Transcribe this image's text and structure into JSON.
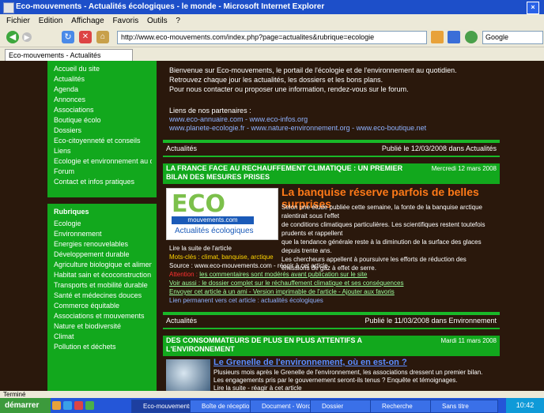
{
  "window": {
    "title": "Eco-mouvements - Actualités écologiques - le monde - Microsoft Internet Explorer"
  },
  "menu": [
    "Fichier",
    "Edition",
    "Affichage",
    "Favoris",
    "Outils",
    "?"
  ],
  "navigation": {
    "address": "http://www.eco-mouvements.com/index.php?page=actualites&rubrique=ecologie",
    "search_placeholder": "Google"
  },
  "tab": {
    "label": "Eco-mouvements - Actualités"
  },
  "sidebar": {
    "top_items": [
      "Accueil du site",
      "Actualités",
      "Agenda",
      "Annonces",
      "Associations",
      "Boutique écolo",
      "Dossiers",
      "Eco-citoyenneté et conseils",
      "Liens",
      "Ecologie et environnement au quotidien",
      "Forum",
      "Contact et infos pratiques"
    ],
    "rubriques_title": "Rubriques",
    "rubriques_items": [
      "Ecologie",
      "Environnement",
      "Energies renouvelables",
      "Développement durable",
      "Agriculture biologique et alimentation saine",
      "Habitat sain et écoconstruction",
      "Transports et mobilité durable",
      "Santé et médecines douces",
      "Commerce équitable",
      "Associations et mouvements",
      "Nature et biodiversité",
      "Climat",
      "Pollution et déchets"
    ]
  },
  "intro": {
    "lines": [
      "Bienvenue sur Eco-mouvements, le portail de l'écologie et de l'environnement au quotidien.",
      "Retrouvez chaque jour les actualités, les dossiers et les bons plans.",
      "Pour nous contacter ou proposer une information, rendez-vous sur le forum."
    ],
    "links_label": "Liens de nos partenaires :",
    "links": [
      "www.eco-annuaire.com - www.eco-infos.org",
      "www.planete-ecologie.fr - www.nature-environnement.org - www.eco-boutique.net"
    ]
  },
  "section1": {
    "left": "Actualités",
    "right": "Publié le 12/03/2008 dans Actualités"
  },
  "article1": {
    "header": "LA FRANCE FACE AU RECHAUFFEMENT CLIMATIQUE : UN PREMIER BILAN DES MESURES PRISES",
    "date": "Mercredi 12 mars 2008",
    "logo_big": "ECO",
    "logo_mid": "mouvements.com",
    "logo_sub": "Actualités écologiques",
    "title": "La banquise réserve parfois de belles surprises",
    "text": [
      "Selon une étude publiée cette semaine, la fonte de la banquise arctique ralentirait sous l'effet",
      "de conditions climatiques particulières. Les scientifiques restent toutefois prudents et rappellent",
      "que la tendance générale reste à la diminution de la surface des glaces depuis trente ans.",
      "Les chercheurs appellent à poursuivre les efforts de réduction des émissions de gaz à effet de serre."
    ],
    "more": {
      "label": "Lire la suite de l'article",
      "tag": "Mots-clés : climat, banquise, arctique",
      "source": "Source : www.eco-mouvements.com - réagir à cet article",
      "red": "Attention :",
      "red_text": "les commentaires sont modérés avant publication sur le site",
      "green1": "Voir aussi : le dossier complet sur le réchauffement climatique et ses conséquences",
      "green2": "Envoyer cet article à un ami - Version imprimable de l'article - Ajouter aux favoris",
      "last": "Lien permanent vers cet article : actualités écologiques"
    }
  },
  "section2": {
    "left": "Actualités",
    "right": "Publié le 11/03/2008 dans Environnement"
  },
  "article2": {
    "header": "DES CONSOMMATEURS DE PLUS EN PLUS ATTENTIFS A L'ENVIRONNEMENT",
    "date": "Mardi 11 mars 2008",
    "title": "Le Grenelle de l'environnement, où en est-on ?",
    "text": [
      "Plusieurs mois après le Grenelle de l'environnement, les associations dressent un premier bilan.",
      "Les engagements pris par le gouvernement seront-ils tenus ? Enquête et témoignages.",
      "Lire la suite - réagir à cet article"
    ]
  },
  "status": "Terminé",
  "taskbar": {
    "start": "démarrer",
    "tasks": [
      "Eco-mouvements",
      "Boîte de réception",
      "Document - Word",
      "Dossier",
      "Recherche",
      "Sans titre"
    ],
    "clock": "10:42"
  },
  "colors": {
    "page_bg": "#2a180c",
    "green": "#12a81d",
    "orange_title": "#ff7a18",
    "link_blue": "#8fb2ff"
  }
}
